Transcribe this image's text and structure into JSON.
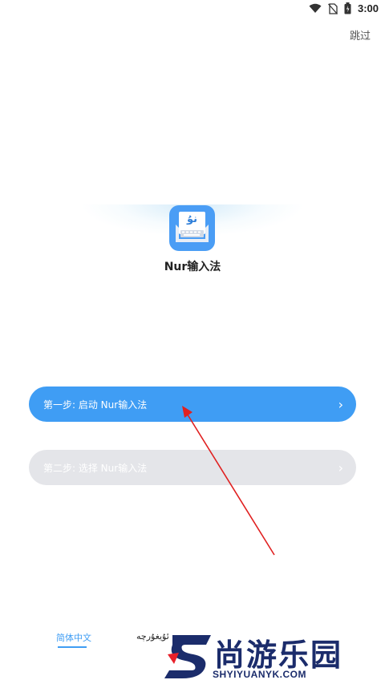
{
  "status_bar": {
    "time": "3:00"
  },
  "header": {
    "skip_label": "跳过"
  },
  "app": {
    "name": "Nur输入法",
    "icon_text": "نۇ"
  },
  "steps": [
    {
      "label": "第一步: 启动 Nur输入法",
      "chevron": "›",
      "state": "active"
    },
    {
      "label": "第二步: 选择 Nur输入法",
      "chevron": "›",
      "state": "disabled"
    }
  ],
  "language_tabs": [
    {
      "label": "简体中文",
      "selected": true
    },
    {
      "label": "ئۇيغۇرچە",
      "selected": false
    }
  ],
  "watermark": {
    "title": "尚游乐园",
    "subtitle": "SHYIYUANYK.COM"
  },
  "colors": {
    "accent": "#3f9df4",
    "disabled": "#e4e5e9",
    "annotation_arrow": "#e02020",
    "watermark_navy": "#1b2c6b",
    "watermark_red": "#e8202a"
  }
}
